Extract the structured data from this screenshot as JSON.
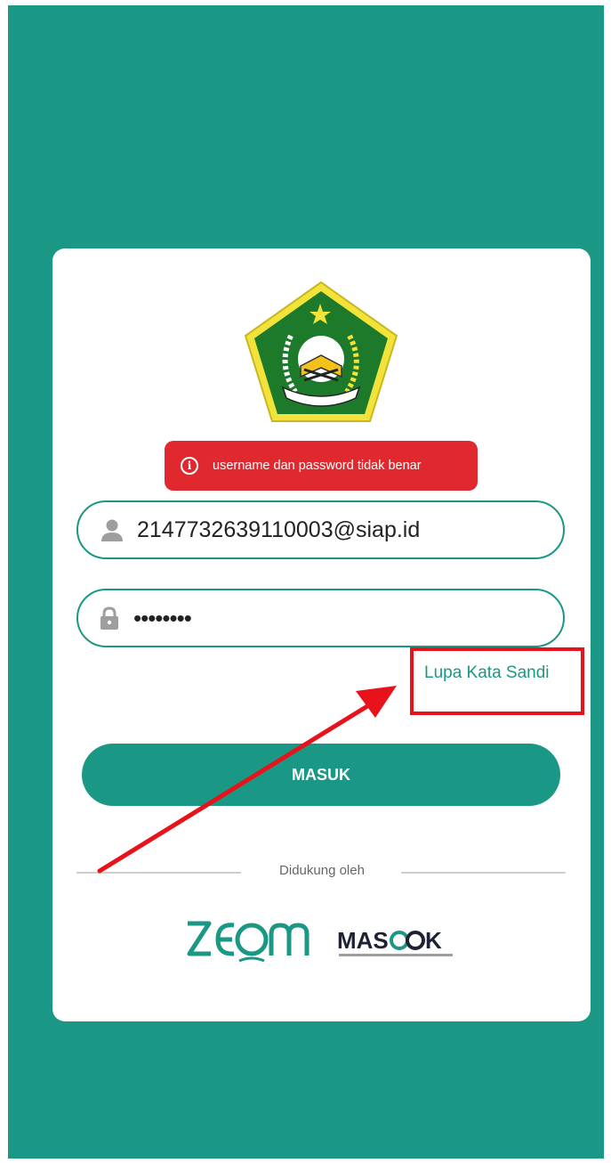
{
  "alert": {
    "icon": "info-icon",
    "message": "username dan password tidak benar"
  },
  "username_field": {
    "icon": "user-icon",
    "value": "2147732639110003@siap.id"
  },
  "password_field": {
    "icon": "lock-icon",
    "value": "••••••••"
  },
  "forgot_password": {
    "label": "Lupa Kata Sandi"
  },
  "login_button": {
    "label": "MASUK"
  },
  "supported_by": {
    "label": "Didukung oleh",
    "partners": [
      "ZOOM",
      "MASOOK"
    ]
  },
  "colors": {
    "primary": "#1b9785",
    "alert": "#e0292e",
    "highlight": "#e8131a"
  }
}
